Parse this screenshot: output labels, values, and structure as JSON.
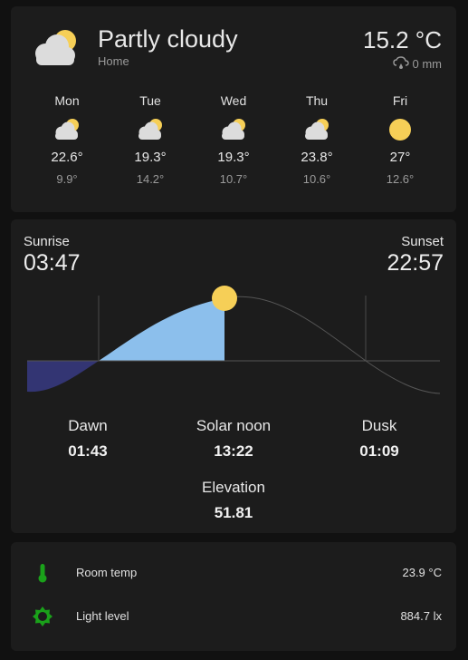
{
  "weather": {
    "condition": "Partly cloudy",
    "location": "Home",
    "temperature": "15.2 °C",
    "precipitation": "0 mm",
    "main_icon": "partly-cloudy-icon",
    "forecast": [
      {
        "day": "Mon",
        "icon": "partly-cloudy-icon",
        "high": "22.6°",
        "low": "9.9°"
      },
      {
        "day": "Tue",
        "icon": "partly-cloudy-icon",
        "high": "19.3°",
        "low": "14.2°"
      },
      {
        "day": "Wed",
        "icon": "partly-cloudy-icon",
        "high": "19.3°",
        "low": "10.7°"
      },
      {
        "day": "Thu",
        "icon": "partly-cloudy-icon",
        "high": "23.8°",
        "low": "10.6°"
      },
      {
        "day": "Fri",
        "icon": "sunny-icon",
        "high": "27°",
        "low": "12.6°"
      }
    ]
  },
  "sun": {
    "sunrise_label": "Sunrise",
    "sunrise": "03:47",
    "sunset_label": "Sunset",
    "sunset": "22:57",
    "dawn_label": "Dawn",
    "dawn": "01:43",
    "noon_label": "Solar noon",
    "noon": "13:22",
    "dusk_label": "Dusk",
    "dusk": "01:09",
    "elevation_label": "Elevation",
    "elevation": "51.81",
    "colors": {
      "day": "#8cbfec",
      "night": "#333573",
      "sun": "#f6cf57",
      "curve": "#555555"
    }
  },
  "entities": [
    {
      "name": "Room temp",
      "value": "23.9 °C",
      "icon": "thermometer-icon",
      "color": "#1aa11a"
    },
    {
      "name": "Light level",
      "value": "884.7 lx",
      "icon": "brightness-icon",
      "color": "#1aa11a"
    }
  ]
}
